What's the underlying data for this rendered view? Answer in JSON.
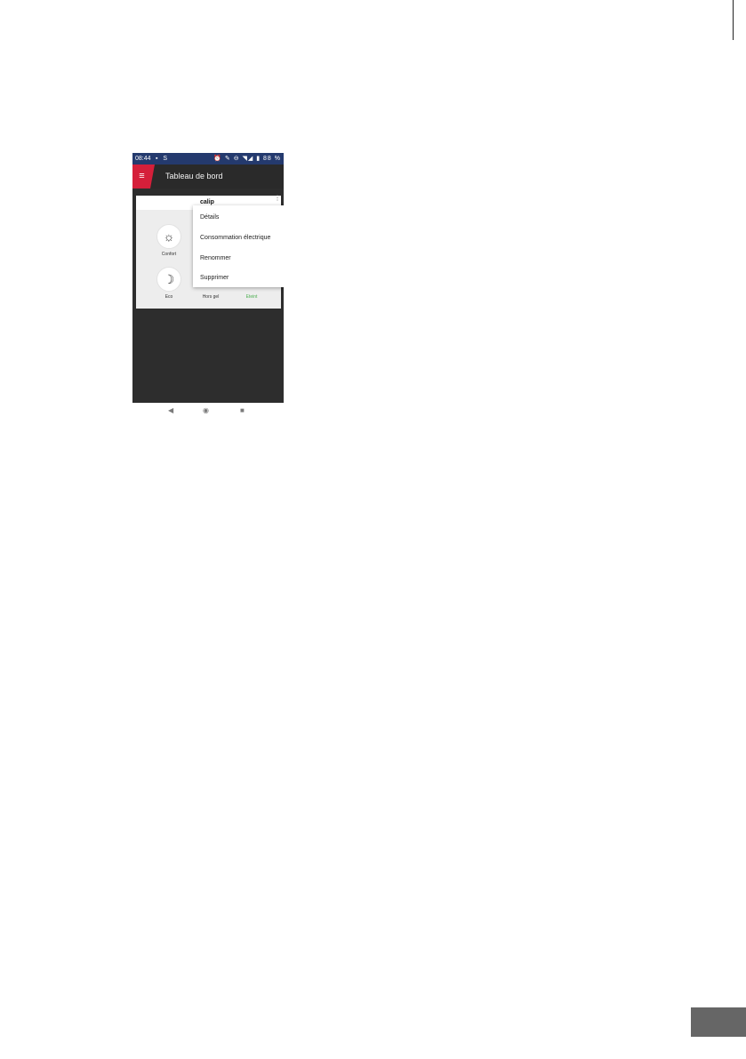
{
  "status_bar": {
    "time": "08:44",
    "left_icons": "▪ S",
    "right_icons": "⏰ ✎ ⊖ ◥◢ ▮ 88 %"
  },
  "app_bar": {
    "menu_icon": "≡",
    "title": "Tableau de bord"
  },
  "card": {
    "title": "calip",
    "more_icon": "⋮",
    "modes": [
      {
        "icon": "☼",
        "label": "Confort"
      },
      {
        "icon": "☽",
        "label": "Eco"
      },
      {
        "icon": "",
        "label": "Hors gel"
      },
      {
        "icon": "",
        "label": "Eteint"
      }
    ]
  },
  "context_menu": {
    "items": [
      "Détails",
      "Consommation électrique",
      "Renommer",
      "Supprimer"
    ]
  },
  "nav_bar": {
    "back": "◀",
    "home": "◉",
    "recent": "■"
  },
  "colors": {
    "status_bar": "#243a6e",
    "accent": "#d51f3a",
    "app_bg": "#2d2d2d",
    "off_label": "#4caf50",
    "page_tab": "#666666"
  }
}
